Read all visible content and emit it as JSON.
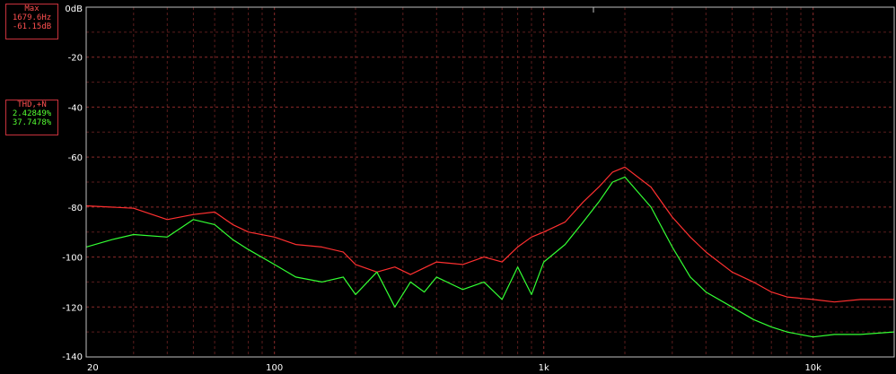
{
  "readouts": {
    "max": {
      "title": "Max",
      "line1": "1679.6Hz",
      "line2": "-61.15dB"
    },
    "thd": {
      "title": "THD,+N",
      "line1": "2.42849%",
      "line2": "37.7478%"
    }
  },
  "colors": {
    "background": "#000000",
    "frame": "#c0c0c0",
    "grid_major": "#8a2a2a",
    "grid_minor": "#5a1c1c",
    "series_red": "#ff3030",
    "series_green": "#33ff33",
    "readout_border": "#c8323c",
    "label": "#ffffff"
  },
  "chart_data": {
    "type": "line",
    "xscale": "log",
    "xlim": [
      20,
      20000
    ],
    "ylim": [
      -140,
      0
    ],
    "grid": true,
    "x_tick_labels": [
      {
        "value": 20,
        "label": "20"
      },
      {
        "value": 100,
        "label": "100"
      },
      {
        "value": 1000,
        "label": "1k"
      },
      {
        "value": 10000,
        "label": "10k"
      }
    ],
    "y_tick_labels": [
      {
        "value": 0,
        "label": "0dB"
      },
      {
        "value": -20,
        "label": "-20"
      },
      {
        "value": -40,
        "label": "-40"
      },
      {
        "value": -60,
        "label": "-60"
      },
      {
        "value": -80,
        "label": "-80"
      },
      {
        "value": -100,
        "label": "-100"
      },
      {
        "value": -120,
        "label": "-120"
      },
      {
        "value": -140,
        "label": "-140"
      }
    ],
    "series": [
      {
        "color": "#ff3030",
        "x": [
          20,
          30,
          40,
          50,
          60,
          70,
          80,
          100,
          120,
          150,
          180,
          200,
          240,
          280,
          320,
          400,
          500,
          600,
          700,
          800,
          900,
          1000,
          1200,
          1400,
          1600,
          1800,
          2000,
          2500,
          3000,
          3500,
          4000,
          5000,
          6000,
          7000,
          8000,
          10000,
          12000,
          15000,
          20000
        ],
        "y": [
          -79.5,
          -80.5,
          -85,
          -83,
          -82,
          -87,
          -90,
          -92,
          -95,
          -96,
          -98,
          -103,
          -106,
          -104,
          -107,
          -102,
          -103,
          -100,
          -102,
          -96,
          -92,
          -90,
          -86,
          -78,
          -72,
          -66,
          -64,
          -72,
          -84,
          -92,
          -98,
          -106,
          -110,
          -114,
          -116,
          -117,
          -118,
          -117,
          -117
        ]
      },
      {
        "color": "#33ff33",
        "x": [
          20,
          25,
          30,
          40,
          50,
          60,
          70,
          80,
          100,
          120,
          150,
          180,
          200,
          240,
          280,
          320,
          360,
          400,
          500,
          600,
          700,
          800,
          900,
          1000,
          1200,
          1400,
          1600,
          1800,
          2000,
          2500,
          3000,
          3500,
          4000,
          5000,
          6000,
          7000,
          8000,
          10000,
          12000,
          15000,
          20000
        ],
        "y": [
          -96,
          -93,
          -91,
          -92,
          -85,
          -87,
          -93,
          -97,
          -103,
          -108,
          -110,
          -108,
          -115,
          -106,
          -120,
          -110,
          -114,
          -108,
          -113,
          -110,
          -117,
          -104,
          -115,
          -102,
          -95,
          -86,
          -78,
          -70,
          -68,
          -80,
          -96,
          -108,
          -114,
          -120,
          -125,
          -128,
          -130,
          -132,
          -131,
          -131,
          -130
        ]
      }
    ]
  }
}
